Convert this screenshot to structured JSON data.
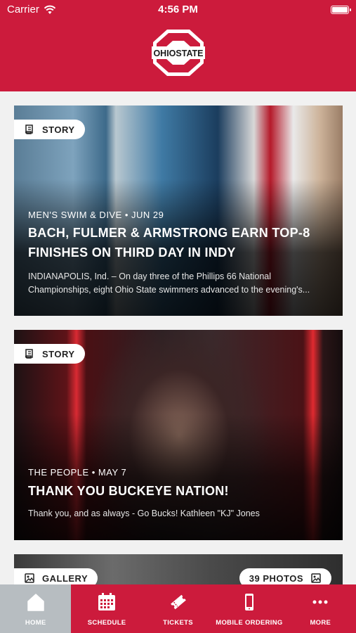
{
  "status_bar": {
    "carrier": "Carrier",
    "time": "4:56 PM",
    "battery_level": 0.9
  },
  "header": {
    "logo_icon": "ohio-state-logo-icon",
    "brand_color": "#cc1b3c"
  },
  "cards": [
    {
      "badge": "STORY",
      "badge_icon": "story-scroll-icon",
      "meta": "MEN'S SWIM & DIVE • JUN 29",
      "title": "BACH, FULMER & ARMSTRONG EARN TOP-8 FINISHES ON THIRD DAY IN INDY",
      "excerpt": "INDIANAPOLIS, Ind. – On day three of the Phillips 66 National Championships, eight Ohio State swimmers advanced to the evening's..."
    },
    {
      "badge": "STORY",
      "badge_icon": "story-scroll-icon",
      "meta": "THE PEOPLE • MAY 7",
      "title": "THANK YOU BUCKEYE NATION!",
      "excerpt": "Thank you, and as always - Go Bucks! Kathleen \"KJ\" Jones"
    },
    {
      "badge": "GALLERY",
      "badge_icon": "gallery-image-icon",
      "photo_count": "39 PHOTOS"
    }
  ],
  "tabbar": {
    "active_color": "#b7bdc1",
    "items": [
      {
        "label": "HOME",
        "icon": "home-icon",
        "active": true
      },
      {
        "label": "SCHEDULE",
        "icon": "calendar-icon",
        "active": false
      },
      {
        "label": "TICKETS",
        "icon": "ticket-icon",
        "active": false
      },
      {
        "label": "MOBILE ORDERING",
        "icon": "mobile-phone-icon",
        "active": false
      },
      {
        "label": "MORE",
        "icon": "more-dots-icon",
        "active": false
      }
    ]
  }
}
